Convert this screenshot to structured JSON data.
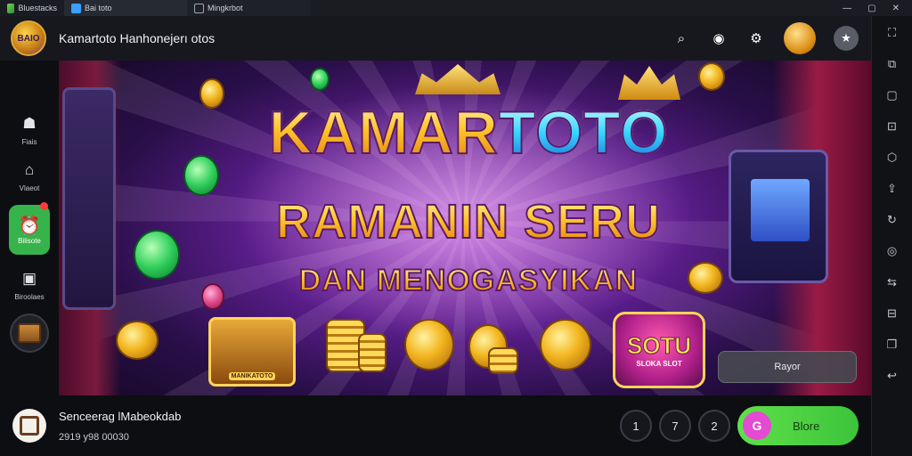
{
  "window": {
    "tabs": [
      {
        "label": "Bluestacks",
        "icon": "bluestacks-logo-icon"
      },
      {
        "label": "Bai toto",
        "icon": "app-tab-icon"
      },
      {
        "label": "Mingkrbot",
        "icon": "window-tab-icon"
      }
    ],
    "controls": [
      "minimize-icon",
      "restore-icon",
      "close-icon"
    ]
  },
  "header": {
    "logo_text": "BAIO",
    "title": "Kamartoto Hanhonejerı otos",
    "actions": [
      {
        "name": "search-icon",
        "glyph": "⌕"
      },
      {
        "name": "play-icon",
        "glyph": "◉"
      },
      {
        "name": "gear-icon",
        "glyph": "⚙"
      },
      {
        "name": "gold-avatar",
        "glyph": ""
      },
      {
        "name": "star-icon",
        "glyph": "★"
      }
    ]
  },
  "sidebar": {
    "items": [
      {
        "label": "Fiais",
        "icon": "profile-icon",
        "glyph": "☗"
      },
      {
        "label": "Vlaeot",
        "icon": "home-icon",
        "glyph": "⌂"
      },
      {
        "label": "Bilisote",
        "icon": "alarm-icon",
        "glyph": "⏰",
        "active": true
      },
      {
        "label": "Biroolaes",
        "icon": "box-icon",
        "glyph": "▣"
      }
    ]
  },
  "banner": {
    "headline_gold": "KAMAR",
    "headline_cyan": "TOTO",
    "line2": "RAMANIN SERU",
    "line3": "DAN MENOGASYIKAN",
    "card_label": "MANIKATOTO",
    "badge_big": "SOTU",
    "badge_small": "SLOKA SLOT",
    "button_label": "Rayor"
  },
  "footer": {
    "title": "Senceerag lMabeokdab",
    "subtitle": "2919 y98 00030",
    "pager": [
      "1",
      "7",
      "2"
    ],
    "more_label": "Blore",
    "more_icon_glyph": "G"
  },
  "toolbar": {
    "tools": [
      {
        "name": "expand-icon",
        "glyph": "⛶"
      },
      {
        "name": "screenshot-icon",
        "glyph": "⧉"
      },
      {
        "name": "window-icon",
        "glyph": "▢"
      },
      {
        "name": "camera-icon",
        "glyph": "⊡"
      },
      {
        "name": "cube-icon",
        "glyph": "⬡"
      },
      {
        "name": "upload-icon",
        "glyph": "⇪"
      },
      {
        "name": "rotate-icon",
        "glyph": "↻"
      },
      {
        "name": "location-icon",
        "glyph": "◎"
      },
      {
        "name": "shake-icon",
        "glyph": "⇆"
      },
      {
        "name": "macro-icon",
        "glyph": "⊟"
      },
      {
        "name": "copy-icon",
        "glyph": "❐"
      },
      {
        "name": "back-icon",
        "glyph": "↩"
      }
    ]
  }
}
